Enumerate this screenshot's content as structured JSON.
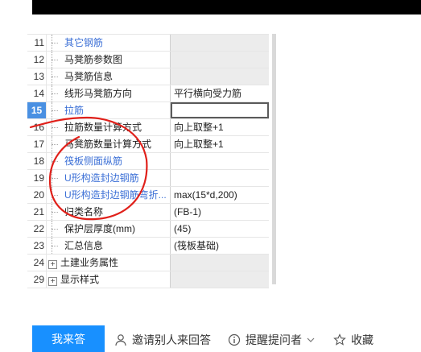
{
  "rows": [
    {
      "num": "11",
      "name": "其它钢筋",
      "value": "",
      "blue": true,
      "gray": true
    },
    {
      "num": "12",
      "name": "马凳筋参数图",
      "value": "",
      "blue": false,
      "gray": true
    },
    {
      "num": "13",
      "name": "马凳筋信息",
      "value": "",
      "blue": false,
      "gray": true
    },
    {
      "num": "14",
      "name": "线形马凳筋方向",
      "value": "平行横向受力筋",
      "blue": false,
      "gray": false
    },
    {
      "num": "15",
      "name": "拉筋",
      "value": "",
      "blue": true,
      "gray": false,
      "active": true,
      "selected": true
    },
    {
      "num": "16",
      "name": "拉筋数量计算方式",
      "value": "向上取整+1",
      "blue": false,
      "gray": false
    },
    {
      "num": "17",
      "name": "马凳筋数量计算方式",
      "value": "向上取整+1",
      "blue": false,
      "gray": false
    },
    {
      "num": "18",
      "name": "筏板侧面纵筋",
      "value": "",
      "blue": true,
      "gray": false
    },
    {
      "num": "19",
      "name": "U形构造封边钢筋",
      "value": "",
      "blue": true,
      "gray": false
    },
    {
      "num": "20",
      "name": "U形构造封边钢筋弯折...",
      "value": "max(15*d,200)",
      "blue": true,
      "gray": false
    },
    {
      "num": "21",
      "name": "归类名称",
      "value": "(FB-1)",
      "blue": false,
      "gray": false
    },
    {
      "num": "22",
      "name": "保护层厚度(mm)",
      "value": "(45)",
      "blue": false,
      "gray": false
    },
    {
      "num": "23",
      "name": "汇总信息",
      "value": "(筏板基础)",
      "blue": false,
      "gray": false
    }
  ],
  "groups": [
    {
      "num": "24",
      "expander": "+",
      "name": "土建业务属性"
    },
    {
      "num": "29",
      "expander": "+",
      "name": "显示样式"
    }
  ],
  "footer": {
    "answer_button": "我来答",
    "invite_label": "邀请别人来回答",
    "remind_label": "提醒提问者",
    "collect_label": "收藏"
  },
  "colors": {
    "accent_blue": "#1890ff",
    "link_blue": "#3b6fd6",
    "annotation_red": "#e0201a"
  }
}
